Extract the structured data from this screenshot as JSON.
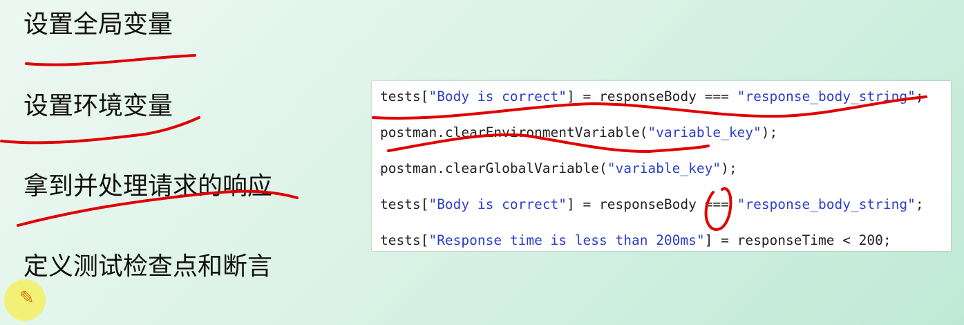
{
  "labels": {
    "set_global": "设置全局变量",
    "set_env": "设置环境变量",
    "handle_response": "拿到并处理请求的响应",
    "define_tests": "定义测试检查点和断言"
  },
  "code": {
    "line1": {
      "a": "tests[",
      "b": "\"Body is correct\"",
      "c": "] = responseBody === ",
      "d": "\"response_body_string\"",
      "e": ";"
    },
    "line2": {
      "a": "postman.clearEnvironmentVariable(",
      "b": "\"variable_key\"",
      "c": ");"
    },
    "line3": {
      "a": "postman.clearGlobalVariable(",
      "b": "\"variable_key\"",
      "c": ");"
    },
    "line4": {
      "a": "tests[",
      "b": "\"Body is correct\"",
      "c": "] = responseBody === ",
      "d": "\"response_body_string\"",
      "e": ";"
    },
    "line5": {
      "a": "tests[",
      "b": "\"Response time is less than 200ms\"",
      "c": "] = responseTime < 200;"
    }
  },
  "colors": {
    "annotation": "#e10000",
    "string": "#2b3fc8",
    "cursor_highlight": "#f4f06a"
  },
  "icons": {
    "cursor": "pen-cursor-icon"
  }
}
